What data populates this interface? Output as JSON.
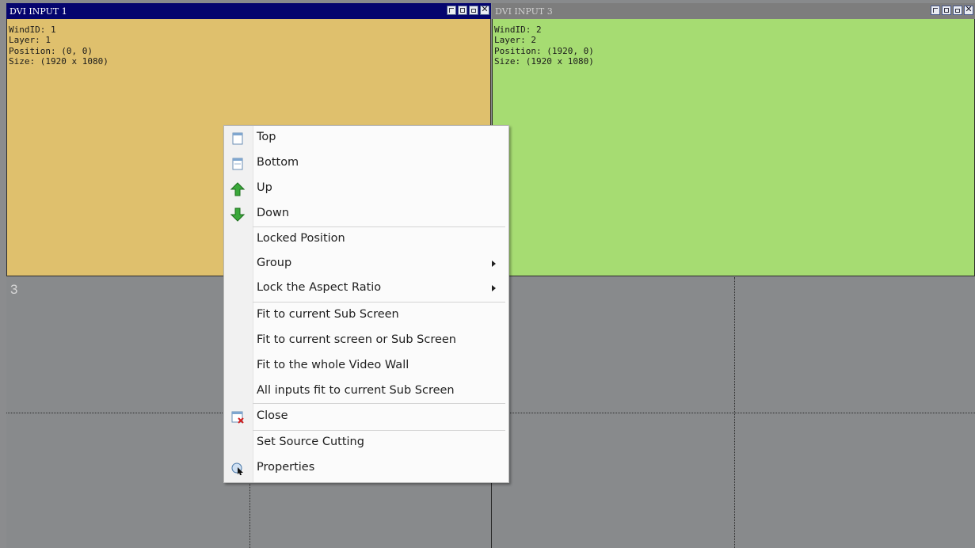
{
  "windows": [
    {
      "title": "DVI INPUT 1",
      "info": [
        "WindID: 1",
        "Layer: 1",
        "Position: (0, 0)",
        "Size: (1920 x 1080)"
      ],
      "title_color": "#04046e",
      "title_text_color": "#ffffff",
      "body_color": "#dfc06d"
    },
    {
      "title": "DVI INPUT 3",
      "info": [
        "WindID: 2",
        "Layer: 2",
        "Position: (1920, 0)",
        "Size: (1920 x 1080)"
      ],
      "title_color": "#7d7d7d",
      "title_text_color": "#cfcfcf",
      "body_color": "#a6dc72"
    }
  ],
  "wall": {
    "cell_label": "3",
    "background": "#888a8c"
  },
  "context_menu": {
    "items": [
      {
        "label": "Top",
        "icon": "top-layer-icon"
      },
      {
        "label": "Bottom",
        "icon": "bottom-layer-icon"
      },
      {
        "label": "Up",
        "icon": "up-arrow-icon"
      },
      {
        "label": "Down",
        "icon": "down-arrow-icon"
      },
      {
        "label": "Locked Position"
      },
      {
        "label": "Group",
        "submenu": true
      },
      {
        "label": "Lock the Aspect Ratio",
        "submenu": true
      },
      {
        "label": "Fit to current Sub Screen"
      },
      {
        "label": "Fit to current screen or Sub Screen"
      },
      {
        "label": "Fit to the whole Video Wall"
      },
      {
        "label": "All inputs fit to current Sub Screen"
      },
      {
        "label": "Close",
        "icon": "close-window-icon"
      },
      {
        "label": "Set Source Cutting"
      },
      {
        "label": "Properties",
        "icon": "properties-icon"
      }
    ]
  }
}
